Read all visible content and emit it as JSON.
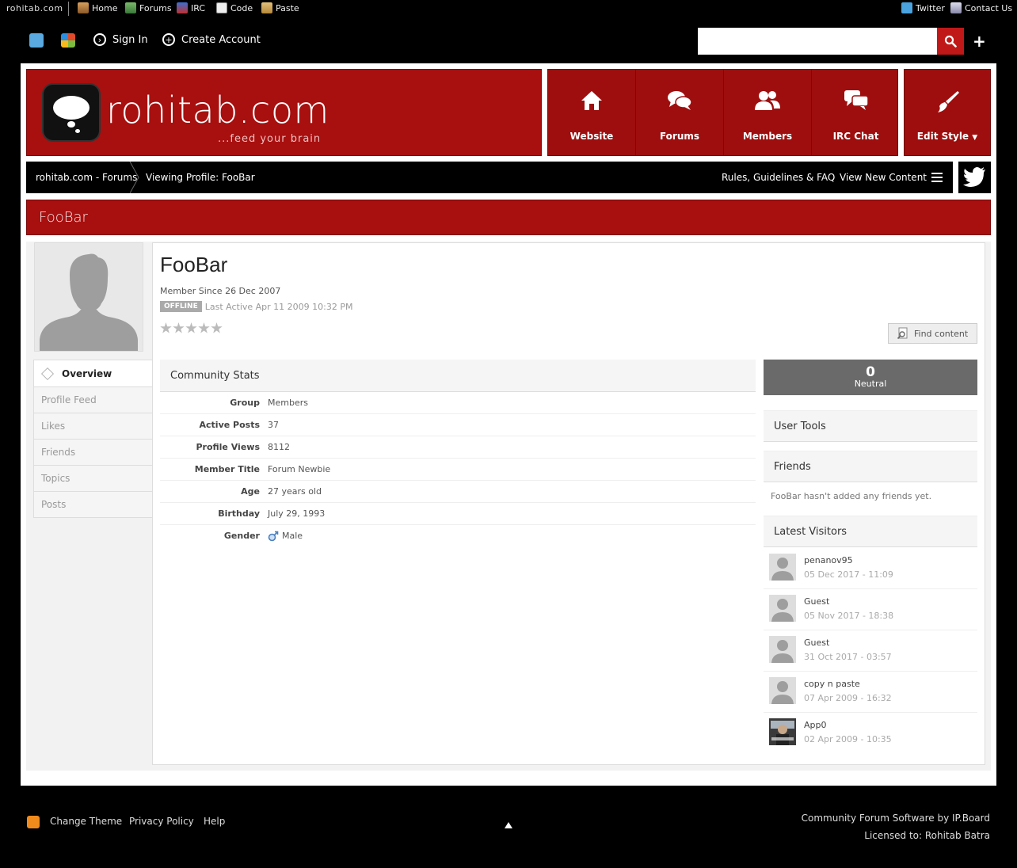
{
  "topbar": {
    "brand": "rohitab.com",
    "nav": [
      "Home",
      "Forums",
      "IRC",
      "Code",
      "Paste"
    ],
    "twitter": "Twitter",
    "contact": "Contact Us"
  },
  "userbar": {
    "sign_in": "Sign In",
    "create_account": "Create Account",
    "search_placeholder": ""
  },
  "header": {
    "logo_text": "rohitab.com",
    "tagline": "...feed your brain",
    "nav": [
      {
        "label": "Website",
        "icon": "home-icon"
      },
      {
        "label": "Forums",
        "icon": "chat-bubbles-icon"
      },
      {
        "label": "Members",
        "icon": "users-icon"
      },
      {
        "label": "IRC Chat",
        "icon": "chat-icon"
      }
    ],
    "edit_style": "Edit Style"
  },
  "breadcrumb": {
    "root": "rohitab.com - Forums",
    "current": "Viewing Profile: FooBar",
    "rules": "Rules, Guidelines & FAQ",
    "new_content": "View New Content"
  },
  "page_title": "FooBar",
  "profile": {
    "name": "FooBar",
    "member_since": "Member Since 26 Dec 2007",
    "status_badge": "OFFLINE",
    "last_active": "Last Active Apr 11 2009 10:32 PM",
    "rating_stars": 0,
    "find_content": "Find content"
  },
  "tabs": [
    "Overview",
    "Profile Feed",
    "Likes",
    "Friends",
    "Topics",
    "Posts"
  ],
  "stats": {
    "title": "Community Stats",
    "rows": [
      {
        "k": "Group",
        "v": "Members"
      },
      {
        "k": "Active Posts",
        "v": "37"
      },
      {
        "k": "Profile Views",
        "v": "8112"
      },
      {
        "k": "Member Title",
        "v": "Forum Newbie"
      },
      {
        "k": "Age",
        "v": "27 years old"
      },
      {
        "k": "Birthday",
        "v": "July 29, 1993"
      },
      {
        "k": "Gender",
        "v": "Male"
      }
    ]
  },
  "reputation": {
    "value": "0",
    "label": "Neutral"
  },
  "sidebar": {
    "user_tools": "User Tools",
    "friends": "Friends",
    "friends_note": "FooBar hasn't added any friends yet.",
    "latest_visitors": "Latest Visitors",
    "visitors": [
      {
        "name": "penanov95",
        "date": "05 Dec 2017 - 11:09"
      },
      {
        "name": "Guest",
        "date": "05 Nov 2017 - 18:38"
      },
      {
        "name": "Guest",
        "date": "31 Oct 2017 - 03:57"
      },
      {
        "name": "copy n paste",
        "date": "07 Apr 2009 - 16:32"
      },
      {
        "name": "App0",
        "date": "02 Apr 2009 - 10:35"
      }
    ]
  },
  "footer": {
    "change_theme": "Change Theme",
    "privacy": "Privacy Policy",
    "help": "Help",
    "software": "Community Forum Software by IP.Board",
    "licensed": "Licensed to: Rohitab Batra"
  },
  "colors": {
    "brand_red": "#a80f0f",
    "search_red": "#c01818"
  }
}
